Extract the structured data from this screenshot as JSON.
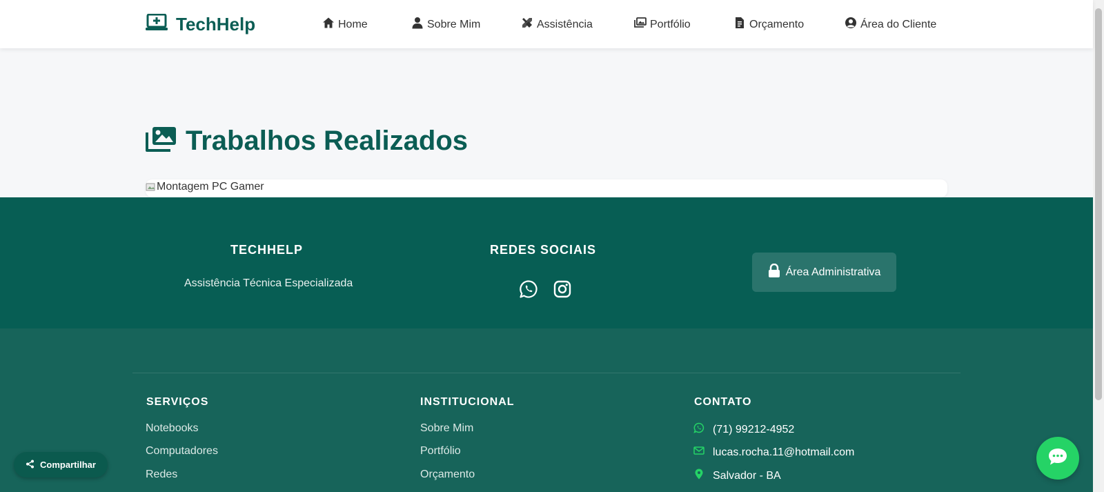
{
  "brand": {
    "name": "TechHelp",
    "icon": "laptop-medical-icon",
    "color": "#0b5d54"
  },
  "nav": {
    "items": [
      {
        "label": "Home",
        "icon": "home-icon"
      },
      {
        "label": "Sobre Mim",
        "icon": "user-icon"
      },
      {
        "label": "Assistência",
        "icon": "tools-icon"
      },
      {
        "label": "Portfólio",
        "icon": "images-icon"
      },
      {
        "label": "Orçamento",
        "icon": "file-invoice-icon"
      },
      {
        "label": "Área do Cliente",
        "icon": "user-circle-icon"
      }
    ]
  },
  "main": {
    "title": "Trabalhos Realizados",
    "title_icon": "images-icon",
    "portfolio_items": [
      {
        "alt": "Montagem PC Gamer"
      }
    ]
  },
  "footer": {
    "about": {
      "title": "TECHHELP",
      "text": "Assistência Técnica Especializada"
    },
    "social": {
      "title": "REDES SOCIAIS",
      "icons": [
        "whatsapp-icon",
        "instagram-icon"
      ]
    },
    "admin_button": "Área Administrativa",
    "services": {
      "title": "SERVIÇOS",
      "links": [
        "Notebooks",
        "Computadores",
        "Redes"
      ]
    },
    "institutional": {
      "title": "INSTITUCIONAL",
      "links": [
        "Sobre Mim",
        "Portfólio",
        "Orçamento"
      ]
    },
    "contact": {
      "title": "CONTATO",
      "phone": "(71) 99212-4952",
      "email": "lucas.rocha.11@hotmail.com",
      "location": "Salvador - BA"
    }
  },
  "floating": {
    "share_label": "Compartilhar",
    "chat_icon": "chat-icon"
  },
  "colors": {
    "primary": "#0b5d54",
    "footer_top": "#075e54",
    "footer_bottom": "#17645a",
    "whatsapp": "#25d366"
  }
}
